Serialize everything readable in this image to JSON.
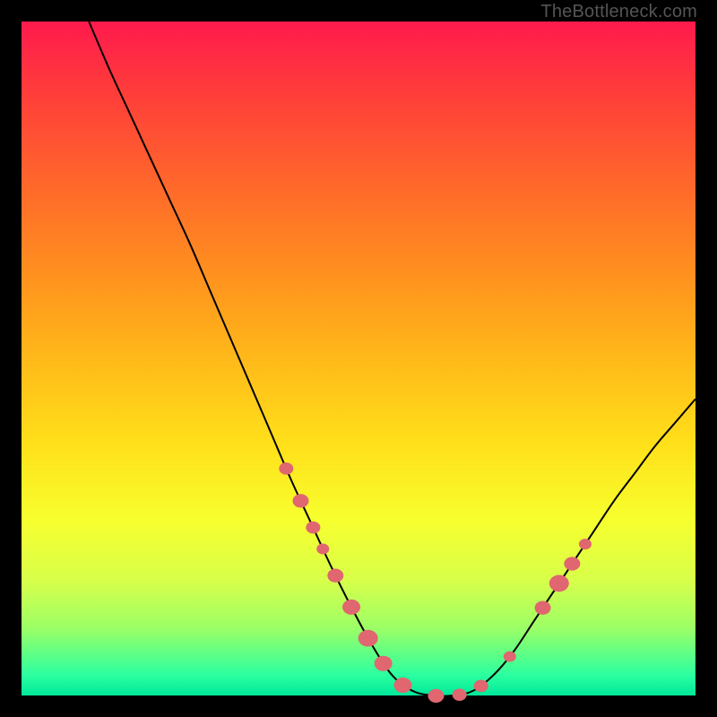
{
  "watermark": "TheBottleneck.com",
  "colors": {
    "frame": "#000000",
    "gradient_top": "#ff1a4d",
    "gradient_bottom": "#00e89a",
    "curve": "#000000",
    "bead": "#e06670"
  },
  "chart_data": {
    "type": "line",
    "title": "",
    "xlabel": "",
    "ylabel": "",
    "xlim": [
      0,
      100
    ],
    "ylim": [
      0,
      100
    ],
    "series": [
      {
        "name": "bottleneck-curve",
        "x": [
          10,
          13,
          16,
          19,
          22,
          25,
          28,
          31,
          34,
          37,
          40,
          43,
          46,
          49,
          52,
          55,
          58,
          61,
          64,
          67,
          70,
          73,
          76,
          79,
          82,
          85,
          88,
          91,
          94,
          97,
          100
        ],
        "y": [
          100,
          93,
          86.5,
          80,
          73.5,
          67,
          60,
          53,
          46,
          39,
          32,
          25.5,
          19,
          13,
          7.5,
          3,
          0.7,
          0,
          0,
          0.7,
          3,
          6.5,
          11,
          15.5,
          20,
          24.5,
          29,
          33,
          37,
          40.5,
          44
        ]
      }
    ],
    "beads": [
      {
        "pos": 0.415,
        "size": 8
      },
      {
        "pos": 0.445,
        "size": 9
      },
      {
        "pos": 0.47,
        "size": 8
      },
      {
        "pos": 0.49,
        "size": 7
      },
      {
        "pos": 0.515,
        "size": 9
      },
      {
        "pos": 0.545,
        "size": 10
      },
      {
        "pos": 0.575,
        "size": 11
      },
      {
        "pos": 0.6,
        "size": 10
      },
      {
        "pos": 0.625,
        "size": 10
      },
      {
        "pos": 0.655,
        "size": 9
      },
      {
        "pos": 0.675,
        "size": 8
      },
      {
        "pos": 0.695,
        "size": 8
      },
      {
        "pos": 0.73,
        "size": 7
      },
      {
        "pos": 0.78,
        "size": 9
      },
      {
        "pos": 0.805,
        "size": 11
      },
      {
        "pos": 0.825,
        "size": 9
      },
      {
        "pos": 0.845,
        "size": 7
      }
    ]
  }
}
